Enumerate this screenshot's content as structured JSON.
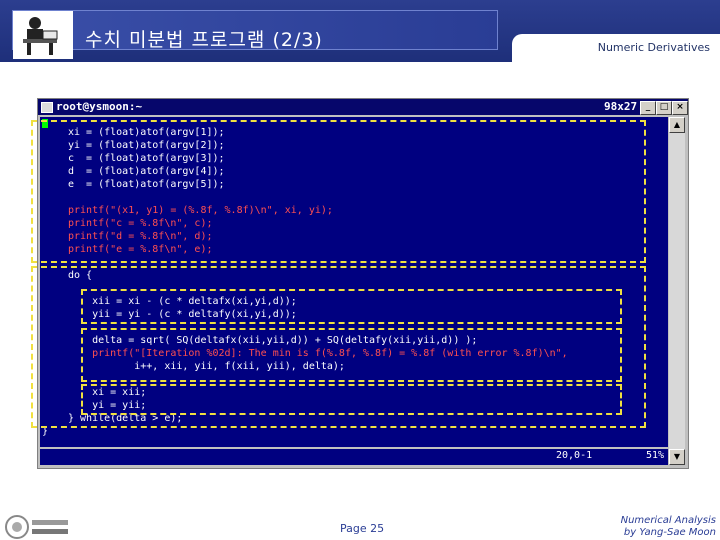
{
  "slide": {
    "title": "수치 미분법 프로그램 (2/3)",
    "subtitle": "Numeric Derivatives",
    "page": "Page 25",
    "credit_line1": "Numerical Analysis",
    "credit_line2": "by Yang-Sae Moon",
    "colors": {
      "header": "#2c3e8f",
      "highlight": "#f0e040",
      "terminal_bg": "#000080"
    }
  },
  "terminal": {
    "title": "root@ysmoon:~",
    "size": "98x27",
    "status_position": "20,0-1",
    "status_percent": "51%",
    "code": [
      "xi = (float)atof(argv[1]);",
      "yi = (float)atof(argv[2]);",
      "c  = (float)atof(argv[3]);",
      "d  = (float)atof(argv[4]);",
      "e  = (float)atof(argv[5]);",
      "",
      "printf(\"(x1, y1) = (%.8f, %.8f)\\n\", xi, yi);",
      "printf(\"c = %.8f\\n\", c);",
      "printf(\"d = %.8f\\n\", d);",
      "printf(\"e = %.8f\\n\", e);",
      "",
      "do {",
      "",
      "    xii = xi - (c * deltafx(xi,yi,d));",
      "    yii = yi - (c * deltafy(xi,yi,d));",
      "",
      "    delta = sqrt( SQ(deltafx(xii,yii,d)) + SQ(deltafy(xii,yii,d)) );",
      "    printf(\"[Iteration %02d]: The min is f(%.8f, %.8f) = %.8f (with error %.8f)\\n\",",
      "           i++, xii, yii, f(xii, yii), delta);",
      "",
      "    xi = xii;",
      "    yi = yii;",
      "} while(delta > e);",
      "}"
    ],
    "buttons": {
      "minimize": "_",
      "maximize": "□",
      "close": "×"
    }
  }
}
